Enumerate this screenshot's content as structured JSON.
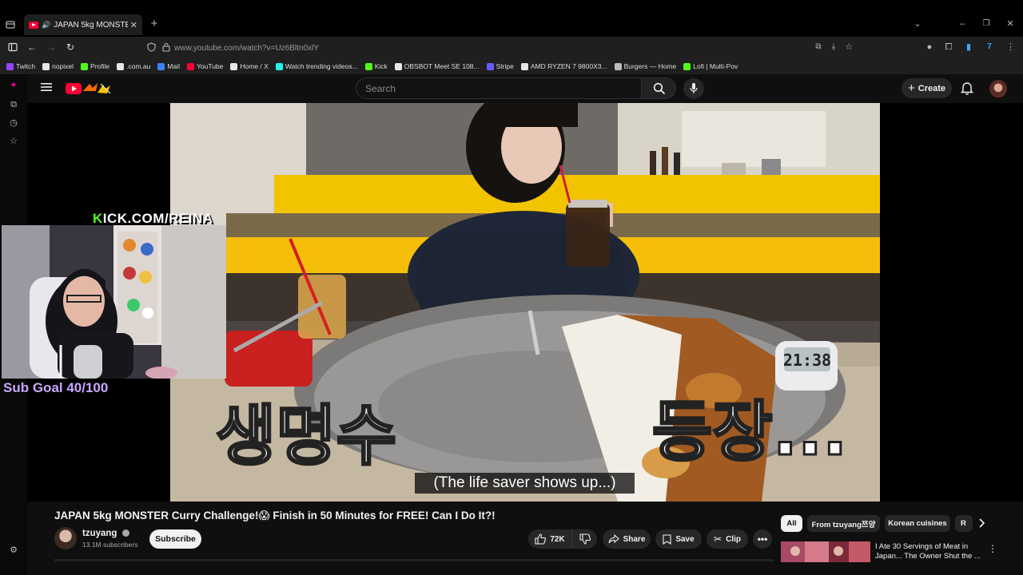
{
  "browser": {
    "tab_title": "JAPAN 5kg MONSTER Curry",
    "url": "www.youtube.com/watch?v=Uz6Bltn0xlY",
    "bookmarks": [
      {
        "label": "Twitch",
        "color": "#9146ff"
      },
      {
        "label": "nopixel",
        "color": "#e7e7e7"
      },
      {
        "label": "Profile",
        "color": "#53fc18"
      },
      {
        "label": ".com.au",
        "color": "#e7e7e7"
      },
      {
        "label": "Mail",
        "color": "#3b82f6"
      },
      {
        "label": "YouTube",
        "color": "#ff0033"
      },
      {
        "label": "Home / X",
        "color": "#e7e7e7"
      },
      {
        "label": "Watch trending videos...",
        "color": "#25f4ee"
      },
      {
        "label": "Kick",
        "color": "#53fc18"
      },
      {
        "label": "OBSBOT Meet SE 108...",
        "color": "#e7e7e7"
      },
      {
        "label": "Stripe",
        "color": "#635bff"
      },
      {
        "label": "AMD RYZEN 7 9800X3...",
        "color": "#e7e7e7"
      },
      {
        "label": "Burgers — Home",
        "color": "#bbbbbb"
      },
      {
        "label": "Lofi | Multi-Pov",
        "color": "#53fc18"
      }
    ]
  },
  "youtube": {
    "search_placeholder": "Search",
    "create_label": "Create"
  },
  "overlay": {
    "kick_text": "KICK.COM/REINA",
    "sub_goal": "Sub Goal 40/100"
  },
  "video": {
    "caption": "(The life saver shows up...)",
    "korean_left": "생명수",
    "korean_right": "등장...",
    "timer": "21:38",
    "title": "JAPAN 5kg MONSTER Curry Challenge!😱 Finish in 50 Minutes for FREE! Can I Do It?!",
    "channel": "tzuyang",
    "subscribers": "13.1M subscribers",
    "subscribe_label": "Subscribe",
    "likes": "72K",
    "share_label": "Share",
    "save_label": "Save",
    "clip_label": "Clip"
  },
  "recommendations": {
    "chips": [
      "All",
      "From tzuyang쯔양",
      "Korean cuisines",
      "R"
    ],
    "first_title": "I Ate 30 Servings of Meat in Japan... The Owner Shut the ..."
  },
  "colors": {
    "yt_red": "#ff0033",
    "kick_green": "#53fc18",
    "sub_goal": "#c9a7ff"
  }
}
